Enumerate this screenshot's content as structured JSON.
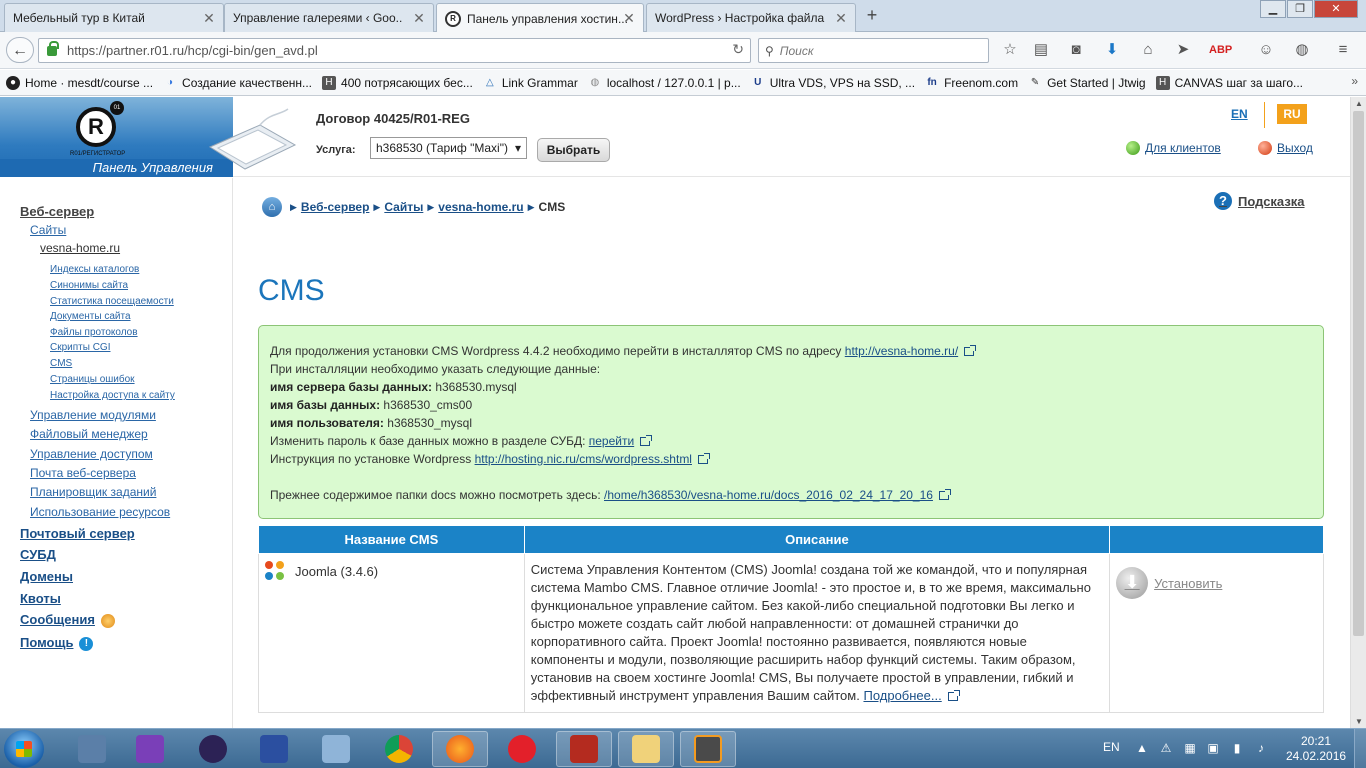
{
  "browser": {
    "tabs": [
      {
        "label": "Мебельный тур в Китай"
      },
      {
        "label": "Управление галереями ‹ Goo..."
      },
      {
        "label": "Панель управления хостин..."
      },
      {
        "label": "WordPress › Настройка файла..."
      }
    ],
    "url": "https://partner.r01.ru/hcp/cgi-bin/gen_avd.pl",
    "search_placeholder": "Поиск",
    "bookmarks": [
      {
        "label": "Home · mesdt/course ..."
      },
      {
        "label": "Создание качественн..."
      },
      {
        "label": "400 потрясающих бес..."
      },
      {
        "label": "Link Grammar"
      },
      {
        "label": "localhost / 127.0.0.1 | p..."
      },
      {
        "label": "Ultra VDS, VPS на SSD, ..."
      },
      {
        "label": "Freenom.com"
      },
      {
        "label": "Get Started | Jtwig"
      },
      {
        "label": "CANVAS шаг за шаго..."
      }
    ]
  },
  "header": {
    "logo_sub": "R01/РЕГИСТРАТОР",
    "logo_badge": "01",
    "panel_label": "Панель Управления",
    "contract": "Договор 40425/R01-REG",
    "service_label": "Услуга:",
    "service_value": "h368530 (Тариф \"Maxi\")",
    "choose_label": "Выбрать",
    "lang_en": "EN",
    "lang_ru": "RU",
    "clients_label": "Для клиентов",
    "logout_label": "Выход"
  },
  "sidebar": {
    "web_server": "Веб-сервер",
    "sites": "Сайты",
    "site": "vesna-home.ru",
    "site_items": [
      "Индексы каталогов",
      "Синонимы сайта",
      "Статистика посещаемости",
      "Документы сайта",
      "Файлы протоколов",
      "Скрипты CGI",
      "CMS",
      "Страницы ошибок",
      "Настройка доступа к сайту"
    ],
    "web_items": [
      "Управление модулями",
      "Файловый менеджер",
      "Управление доступом",
      "Почта веб-сервера",
      "Планировщик заданий",
      "Использование ресурсов"
    ],
    "sections": [
      "Почтовый сервер",
      "СУБД",
      "Домены",
      "Квоты",
      "Сообщения",
      "Помощь"
    ]
  },
  "breadcrumb": [
    "Веб-сервер",
    "Сайты",
    "vesna-home.ru",
    "CMS"
  ],
  "hint_label": "Подсказка",
  "page_title": "CMS",
  "notice": {
    "line1_text": "Для продолжения установки CMS Wordpress 4.4.2 необходимо перейти в инсталлятор CMS по адресу ",
    "line1_link": "http://vesna-home.ru/",
    "line2": "При инсталляции необходимо указать следующие данные:",
    "db_server_label": "имя сервера базы данных:",
    "db_server_value": " h368530.mysql",
    "db_name_label": "имя базы данных:",
    "db_name_value": " h368530_cms00",
    "db_user_label": "имя пользователя:",
    "db_user_value": " h368530_mysql",
    "pwd_text": "Изменить пароль к базе данных можно в разделе СУБД: ",
    "pwd_link": "перейти",
    "instr_text": "Инструкция по установке Wordpress ",
    "instr_link": "http://hosting.nic.ru/cms/wordpress.shtml",
    "docs_text": "Прежнее содержимое папки docs можно посмотреть здесь: ",
    "docs_link": "/home/h368530/vesna-home.ru/docs_2016_02_24_17_20_16"
  },
  "cms_table": {
    "headers": [
      "Название CMS",
      "Описание",
      ""
    ],
    "rows": [
      {
        "name": "Joomla (3.4.6)",
        "description": "Система Управления Контентом (CMS) Joomla! создана той же командой, что и популярная система Mambo CMS. Главное отличие Joomla! - это простое и, в то же время, максимально функциональное управление сайтом. Без какой-либо специальной подготовки Вы легко и быстро можете создать сайт любой направленности: от домашней странички до корпоративного сайта. Проект Joomla! постоянно развивается, появляются новые компоненты и модули, позволяющие расширить набор функций системы. Таким образом, установив на своем хостинге Joomla! CMS, Вы получаете простой в управлении, гибкий и эффективный инструмент управления Вашим сайтом.",
        "more_link": "Подробнее...",
        "action": "Установить"
      }
    ]
  },
  "taskbar": {
    "lang": "EN",
    "time": "20:21",
    "date": "24.02.2016"
  }
}
